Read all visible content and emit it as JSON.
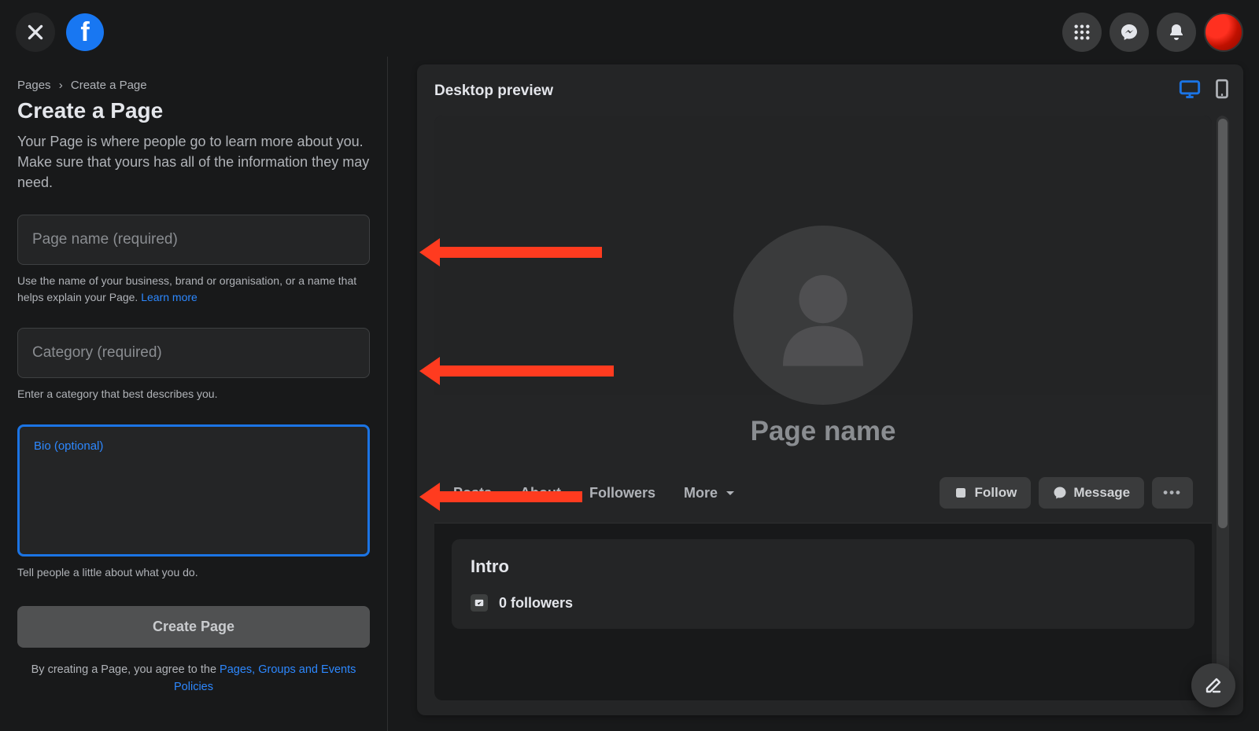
{
  "header": {
    "icons": {
      "menu": "menu-grid",
      "messenger": "messenger",
      "notifications": "bell"
    }
  },
  "breadcrumb": {
    "root": "Pages",
    "separator": "›",
    "current": "Create a Page"
  },
  "title": "Create a Page",
  "description": "Your Page is where people go to learn more about you. Make sure that yours has all of the information they may need.",
  "fields": {
    "page_name": {
      "label": "Page name (required)",
      "helper_prefix": "Use the name of your business, brand or organisation, or a name that helps explain your Page. ",
      "helper_link": "Learn more"
    },
    "category": {
      "label": "Category (required)",
      "helper": "Enter a category that best describes you."
    },
    "bio": {
      "label": "Bio (optional)",
      "helper": "Tell people a little about what you do."
    }
  },
  "submit_label": "Create Page",
  "legal": {
    "prefix": "By creating a Page, you agree to the ",
    "link": "Pages, Groups and Events Policies"
  },
  "preview": {
    "title": "Desktop preview",
    "page_name_placeholder": "Page name",
    "tabs": [
      "Posts",
      "About",
      "Followers",
      "More"
    ],
    "actions": {
      "follow": "Follow",
      "message": "Message"
    },
    "intro": {
      "title": "Intro",
      "followers": "0 followers"
    }
  }
}
